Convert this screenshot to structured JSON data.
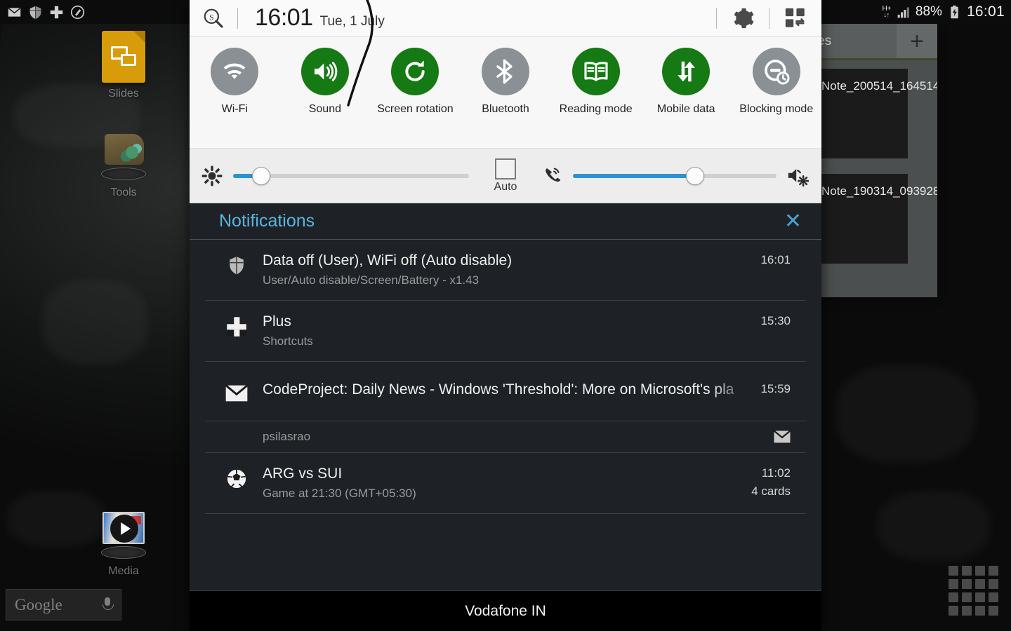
{
  "statusbar": {
    "left_icons": [
      "envelope-icon",
      "shield-icon",
      "plus-icon",
      "pen-circle-icon"
    ],
    "network_type": "H+",
    "battery_percent": "88%",
    "time": "16:01"
  },
  "homescreen": {
    "icons": [
      {
        "label": "Slides",
        "icon": "google-slides-icon"
      },
      {
        "label": "Tools",
        "icon": "tools-folder-icon"
      },
      {
        "label": "Media",
        "icon": "media-folder-icon"
      }
    ],
    "search_widget": {
      "text": "Google",
      "mic": "microphone-icon"
    },
    "apps_button": "apps-grid-icon"
  },
  "background_app": {
    "tab_label": "es",
    "add_label": "+",
    "notes": [
      "Note_200514_164514",
      "Note_190314_093928"
    ]
  },
  "panel": {
    "header": {
      "search_icon": "search-s-icon",
      "time": "16:01",
      "date": "Tue, 1 July",
      "settings_icon": "gear-icon",
      "edit_icon": "edit-toggles-icon"
    },
    "toggles": [
      {
        "label": "Wi-Fi",
        "icon": "wifi-icon",
        "state": "off"
      },
      {
        "label": "Sound",
        "icon": "sound-icon",
        "state": "on"
      },
      {
        "label": "Screen rotation",
        "icon": "screen-rotation-icon",
        "state": "on"
      },
      {
        "label": "Bluetooth",
        "icon": "bluetooth-icon",
        "state": "off"
      },
      {
        "label": "Reading mode",
        "icon": "reading-mode-icon",
        "state": "on"
      },
      {
        "label": "Mobile data",
        "icon": "mobile-data-icon",
        "state": "on"
      },
      {
        "label": "Blocking mode",
        "icon": "blocking-mode-icon",
        "state": "off"
      }
    ],
    "sliders": {
      "brightness": {
        "icon": "brightness-gear-icon",
        "value": 12,
        "auto_label": "Auto",
        "auto_checked": false
      },
      "volume": {
        "icon": "ringer-icon",
        "value": 60,
        "settings_icon": "volume-settings-icon"
      }
    },
    "notifications": {
      "title": "Notifications",
      "close_label": "✕",
      "items": [
        {
          "icon": "shield-icon",
          "title": "Data off (User), WiFi off (Auto disable)",
          "subtitle": "User/Auto disable/Screen/Battery - x1.43",
          "time": "16:01",
          "extra": "",
          "truncated": false
        },
        {
          "icon": "plus-icon",
          "title": "Plus",
          "subtitle": "Shortcuts",
          "time": "15:30",
          "extra": "",
          "truncated": false
        },
        {
          "icon": "envelope-icon",
          "title": "CodeProject: Daily News - Windows 'Threshold': More on Microsoft's pla",
          "subtitle": "",
          "time": "15:59",
          "extra": "",
          "truncated": true
        },
        {
          "icon": "envelope-small-icon",
          "title": "psilasrao",
          "subtitle": "",
          "time": "",
          "extra": "",
          "sender_row": true
        },
        {
          "icon": "soccer-ball-icon",
          "title": "ARG vs SUI",
          "subtitle": "Game at 21:30 (GMT+05:30)",
          "time": "11:02",
          "extra": "4 cards",
          "truncated": false
        }
      ]
    },
    "carrier": "Vodafone IN"
  },
  "colors": {
    "toggle_on": "#157a13",
    "toggle_off": "#8a9094",
    "accent_blue": "#2b93cf",
    "notif_title_blue": "#5ab4e0",
    "panel_dark": "#1e2226"
  }
}
